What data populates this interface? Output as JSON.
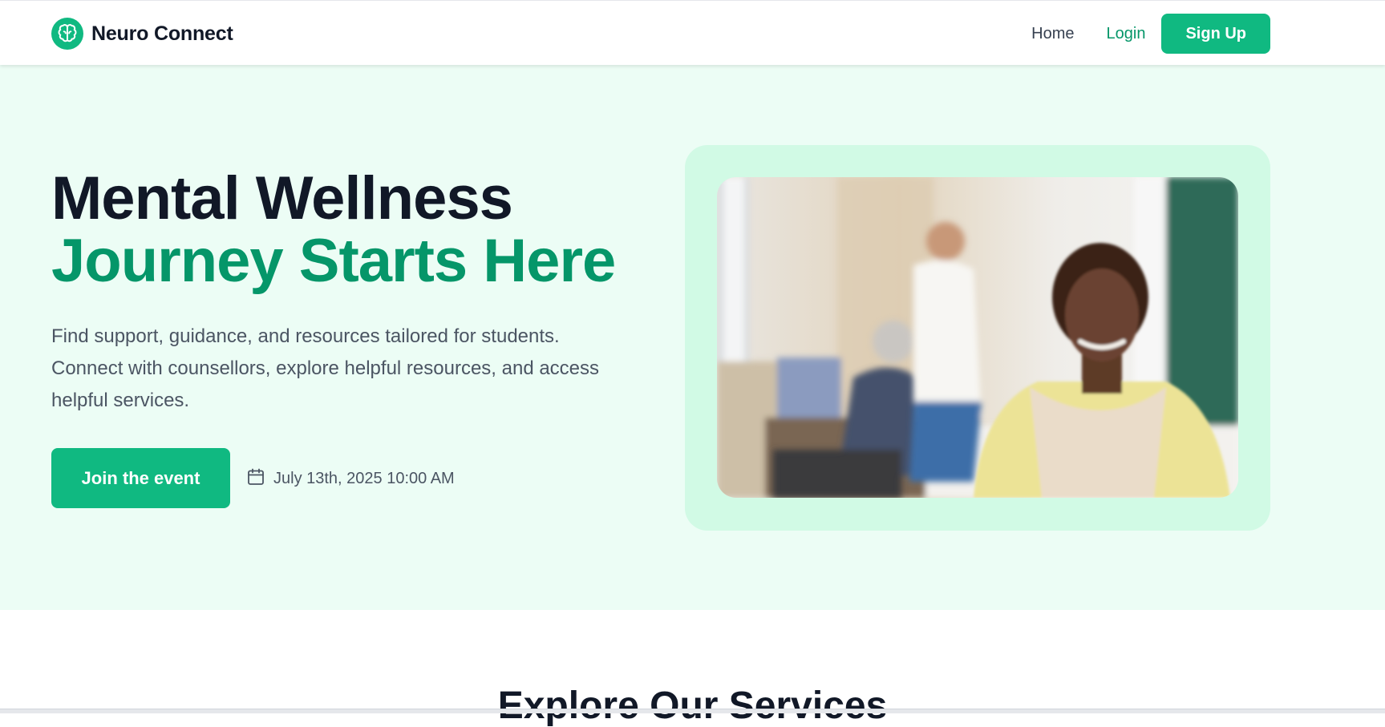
{
  "brand": {
    "name": "Neuro Connect",
    "logo_icon": "brain-icon"
  },
  "nav": {
    "home_label": "Home",
    "login_label": "Login",
    "signup_label": "Sign Up"
  },
  "hero": {
    "title_line1": "Mental Wellness",
    "title_line2": "Journey Starts Here",
    "description": "Find support, guidance, and resources tailored for students. Connect with counsellors, explore helpful resources, and access helpful services.",
    "cta_label": "Join the event",
    "event_date": "July 13th, 2025 10:00 AM",
    "date_icon": "calendar-icon"
  },
  "services": {
    "heading": "Explore Our Services"
  },
  "colors": {
    "accent": "#10b981",
    "accent_dark": "#059669",
    "hero_bg": "#ecfdf5",
    "card_bg": "#d1fae5",
    "text_dark": "#111827",
    "text_muted": "#4b5563"
  }
}
